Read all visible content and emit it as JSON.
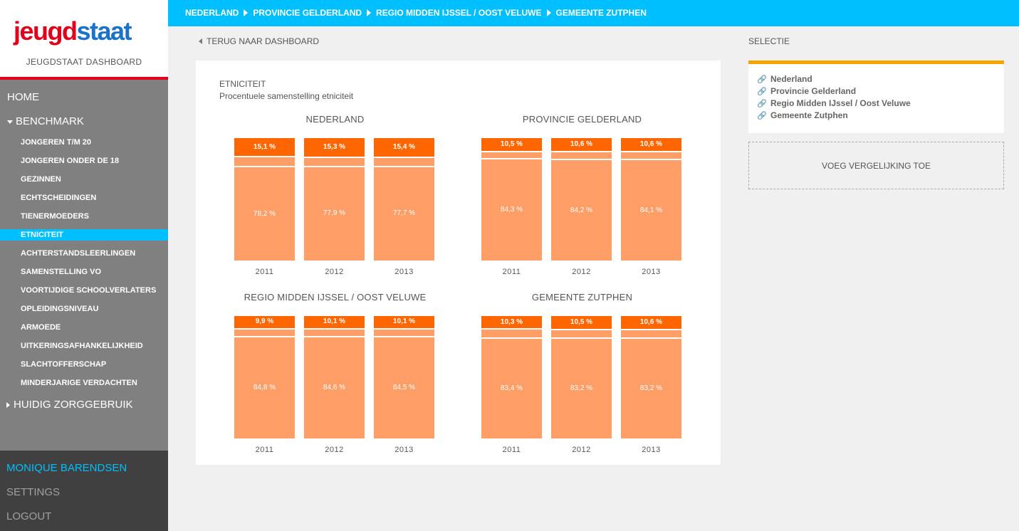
{
  "brand": {
    "logo_part1": "jeugd",
    "logo_part2": "staat",
    "dashboard_title": "JEUGDSTAAT DASHBOARD"
  },
  "nav": {
    "home": "HOME",
    "benchmark": "BENCHMARK",
    "sub_items": [
      "JONGEREN T/M 20",
      "JONGEREN ONDER DE 18",
      "GEZINNEN",
      "ECHTSCHEIDINGEN",
      "TIENERMOEDERS",
      "ETNICITEIT",
      "ACHTERSTANDSLEERLINGEN",
      "SAMENSTELLING VO",
      "VOORTIJDIGE SCHOOLVERLATERS",
      "OPLEIDINGSNIVEAU",
      "ARMOEDE",
      "UITKERINGSAFHANKELIJKHEID",
      "SLACHTOFFERSCHAP",
      "MINDERJARIGE VERDACHTEN"
    ],
    "active_item": "ETNICITEIT",
    "huidig": "HUIDIG ZORGGEBRUIK"
  },
  "user": {
    "name": "MONIQUE BARENDSEN",
    "settings": "SETTINGS",
    "logout": "LOGOUT"
  },
  "breadcrumb": [
    "NEDERLAND",
    "PROVINCIE GELDERLAND",
    "REGIO MIDDEN IJSSEL / OOST VELUWE",
    "GEMEENTE ZUTPHEN"
  ],
  "back_link": "TERUG NAAR DASHBOARD",
  "panel": {
    "title": "ETNICITEIT",
    "subtitle": "Procentuele samenstelling etniciteit"
  },
  "chart_data": [
    {
      "type": "bar",
      "title": "NEDERLAND",
      "categories": [
        "2011",
        "2012",
        "2013"
      ],
      "series": [
        {
          "values": [
            15.1,
            15.3,
            15.4
          ],
          "labels": [
            "15,1 %",
            "15,3 %",
            "15,4 %"
          ]
        },
        {
          "values": [
            6.7,
            6.8,
            6.9
          ]
        },
        {
          "values": [
            78.2,
            77.9,
            77.7
          ],
          "labels": [
            "78,2 %",
            "77,9 %",
            "77,7 %"
          ]
        }
      ],
      "stacked": true,
      "ylim": [
        0,
        100
      ]
    },
    {
      "type": "bar",
      "title": "PROVINCIE GELDERLAND",
      "categories": [
        "2011",
        "2012",
        "2013"
      ],
      "series": [
        {
          "values": [
            10.5,
            10.6,
            10.6
          ],
          "labels": [
            "10,5 %",
            "10,6 %",
            "10,6 %"
          ]
        },
        {
          "values": [
            5.2,
            5.2,
            5.3
          ]
        },
        {
          "values": [
            84.3,
            84.2,
            84.1
          ],
          "labels": [
            "84,3 %",
            "84,2 %",
            "84,1 %"
          ]
        }
      ],
      "stacked": true,
      "ylim": [
        0,
        100
      ]
    },
    {
      "type": "bar",
      "title": "REGIO MIDDEN IJSSEL / OOST VELUWE",
      "categories": [
        "2011",
        "2012",
        "2013"
      ],
      "series": [
        {
          "values": [
            9.9,
            10.1,
            10.1
          ],
          "labels": [
            "9,9 %",
            "10,1 %",
            "10,1 %"
          ]
        },
        {
          "values": [
            5.3,
            5.3,
            5.4
          ]
        },
        {
          "values": [
            84.8,
            84.6,
            84.5
          ],
          "labels": [
            "84,8 %",
            "84,6 %",
            "84,5 %"
          ]
        }
      ],
      "stacked": true,
      "ylim": [
        0,
        100
      ]
    },
    {
      "type": "bar",
      "title": "GEMEENTE ZUTPHEN",
      "categories": [
        "2011",
        "2012",
        "2013"
      ],
      "series": [
        {
          "values": [
            10.3,
            10.5,
            10.6
          ],
          "labels": [
            "10,3 %",
            "10,5 %",
            "10,6 %"
          ]
        },
        {
          "values": [
            6.3,
            6.3,
            6.2
          ]
        },
        {
          "values": [
            83.4,
            83.2,
            83.2
          ],
          "labels": [
            "83,4 %",
            "83,2 %",
            "83,2 %"
          ]
        }
      ],
      "stacked": true,
      "ylim": [
        0,
        100
      ]
    }
  ],
  "selection": {
    "label": "SELECTIE",
    "items": [
      "Nederland",
      "Provincie Gelderland",
      "Regio Midden IJssel / Oost Veluwe",
      "Gemeente Zutphen"
    ],
    "add_compare": "VOEG VERGELIJKING TOE"
  },
  "colors": {
    "accent": "#00bfff",
    "brand_red": "#e2001a",
    "brand_blue": "#1a73c9",
    "bar_dark": "#ff6600",
    "bar_light": "#ff9e66",
    "selection_border": "#f5a300"
  }
}
